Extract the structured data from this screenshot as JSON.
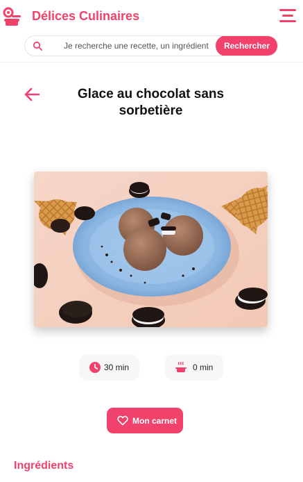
{
  "app": {
    "name": "Délices Culinaires",
    "logo_icon": "chef-cooking-icon",
    "accent_color": "#f0426a",
    "menu_icon": "hamburger-menu-icon"
  },
  "search": {
    "placeholder": "Je recherche une recette, un ingrédient",
    "value": "",
    "button_label": "Rechercher",
    "icon": "search-icon"
  },
  "recipe": {
    "back_icon": "arrow-left-icon",
    "title": "Glace au chocolat sans sorbetière",
    "image_alt": "Boules de glace au chocolat sur une assiette bleue avec biscuits et cornets",
    "prep_time": "30 min",
    "prep_icon": "clock-icon",
    "cook_time": "0 min",
    "cook_icon": "cooking-pot-icon",
    "favorite_label": "Mon carnet",
    "favorite_icon": "heart-icon"
  },
  "sections": {
    "ingredients_title": "Ingrédients"
  }
}
